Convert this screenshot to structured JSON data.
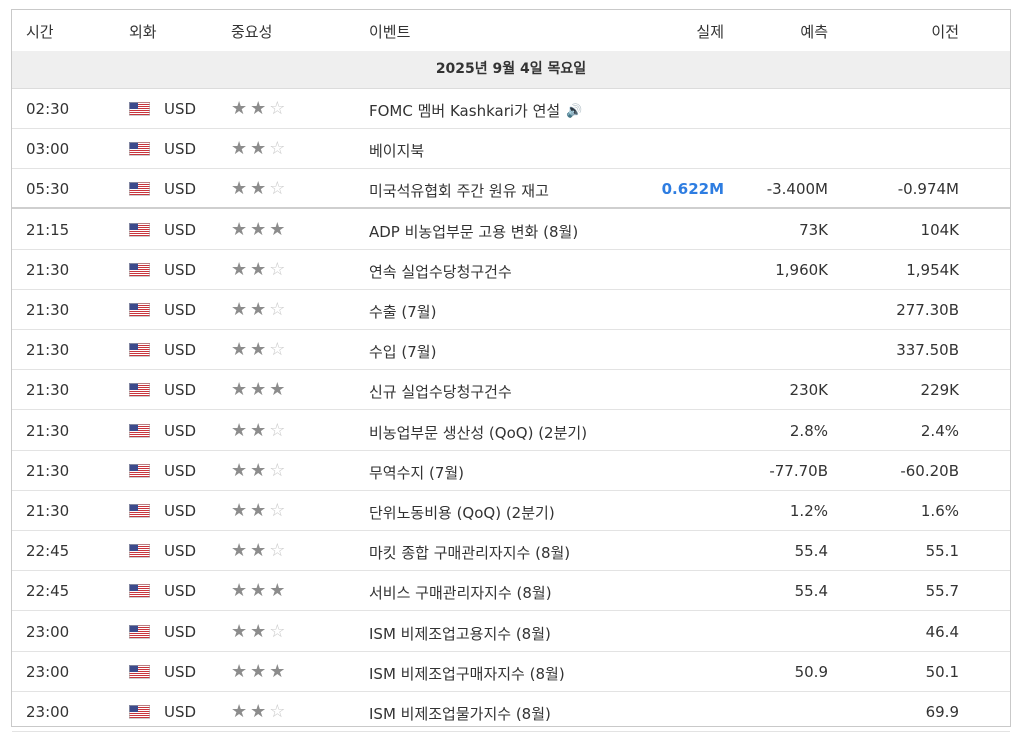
{
  "headers": {
    "time": "시간",
    "currency": "외화",
    "importance": "중요성",
    "event": "이벤트",
    "actual": "실제",
    "forecast": "예측",
    "previous": "이전"
  },
  "date_label": "2025년 9월 4일 목요일",
  "flag_icon": "us-flag-icon",
  "speaker_glyph": "🔊",
  "rows": [
    {
      "time": "02:30",
      "currency": "USD",
      "stars": 2,
      "event": "FOMC 멤버 Kashkari가 연설",
      "actual": "",
      "forecast": "",
      "previous": "",
      "speaker": true
    },
    {
      "time": "03:00",
      "currency": "USD",
      "stars": 2,
      "event": "베이지북",
      "actual": "",
      "forecast": "",
      "previous": ""
    },
    {
      "time": "05:30",
      "currency": "USD",
      "stars": 2,
      "event": "미국석유협회 주간 원유 재고",
      "actual": "0.622M",
      "forecast": "-3.400M",
      "previous": "-0.974M",
      "thick": true
    },
    {
      "time": "21:15",
      "currency": "USD",
      "stars": 3,
      "event": "ADP 비농업부문 고용 변화 (8월)",
      "actual": "",
      "forecast": "73K",
      "previous": "104K"
    },
    {
      "time": "21:30",
      "currency": "USD",
      "stars": 2,
      "event": "연속 실업수당청구건수",
      "actual": "",
      "forecast": "1,960K",
      "previous": "1,954K"
    },
    {
      "time": "21:30",
      "currency": "USD",
      "stars": 2,
      "event": "수출 (7월)",
      "actual": "",
      "forecast": "",
      "previous": "277.30B"
    },
    {
      "time": "21:30",
      "currency": "USD",
      "stars": 2,
      "event": "수입 (7월)",
      "actual": "",
      "forecast": "",
      "previous": "337.50B"
    },
    {
      "time": "21:30",
      "currency": "USD",
      "stars": 3,
      "event": "신규 실업수당청구건수",
      "actual": "",
      "forecast": "230K",
      "previous": "229K"
    },
    {
      "time": "21:30",
      "currency": "USD",
      "stars": 2,
      "event": "비농업부문 생산성 (QoQ) (2분기)",
      "actual": "",
      "forecast": "2.8%",
      "previous": "2.4%"
    },
    {
      "time": "21:30",
      "currency": "USD",
      "stars": 2,
      "event": "무역수지 (7월)",
      "actual": "",
      "forecast": "-77.70B",
      "previous": "-60.20B"
    },
    {
      "time": "21:30",
      "currency": "USD",
      "stars": 2,
      "event": "단위노동비용 (QoQ) (2분기)",
      "actual": "",
      "forecast": "1.2%",
      "previous": "1.6%"
    },
    {
      "time": "22:45",
      "currency": "USD",
      "stars": 2,
      "event": "마킷 종합 구매관리자지수 (8월)",
      "actual": "",
      "forecast": "55.4",
      "previous": "55.1"
    },
    {
      "time": "22:45",
      "currency": "USD",
      "stars": 3,
      "event": "서비스 구매관리자지수 (8월)",
      "actual": "",
      "forecast": "55.4",
      "previous": "55.7"
    },
    {
      "time": "23:00",
      "currency": "USD",
      "stars": 2,
      "event": "ISM 비제조업고용지수 (8월)",
      "actual": "",
      "forecast": "",
      "previous": "46.4"
    },
    {
      "time": "23:00",
      "currency": "USD",
      "stars": 3,
      "event": "ISM 비제조업구매자지수 (8월)",
      "actual": "",
      "forecast": "50.9",
      "previous": "50.1"
    },
    {
      "time": "23:00",
      "currency": "USD",
      "stars": 2,
      "event": "ISM 비제조업물가지수 (8월)",
      "actual": "",
      "forecast": "",
      "previous": "69.9"
    }
  ]
}
